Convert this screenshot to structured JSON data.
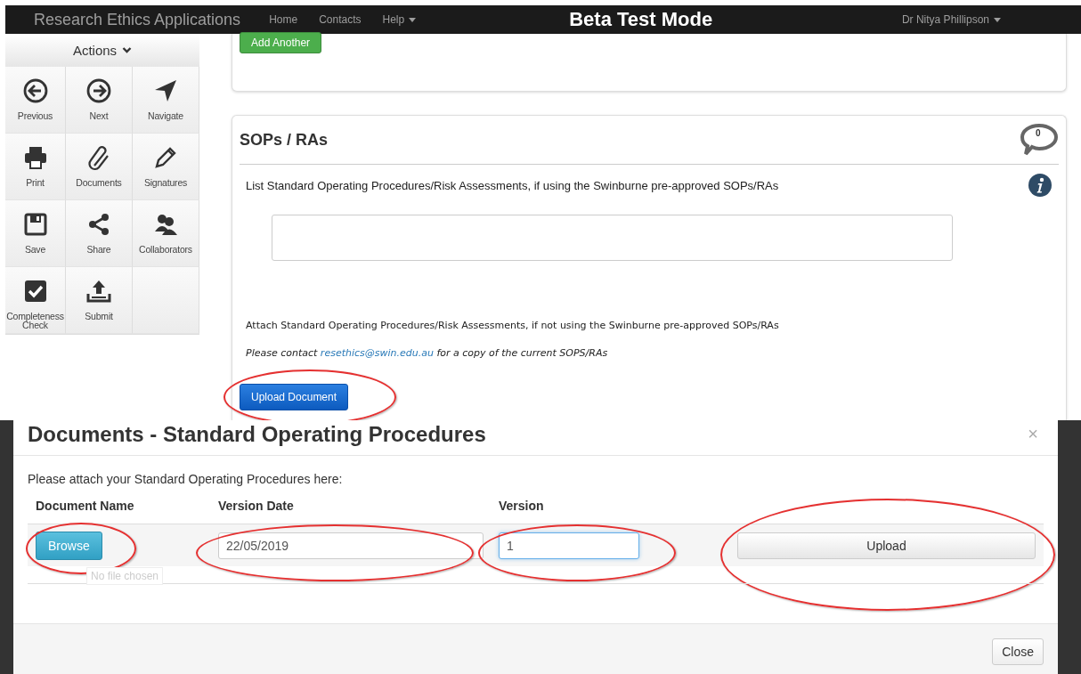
{
  "navbar": {
    "brand": "Research Ethics Applications",
    "links": [
      {
        "label": "Home",
        "caret": false
      },
      {
        "label": "Contacts",
        "caret": false
      },
      {
        "label": "Help",
        "caret": true
      }
    ],
    "mode": "Beta Test Mode",
    "user": "Dr Nitya Phillipson"
  },
  "sidebar": {
    "header": "Actions",
    "actions": [
      {
        "label": "Previous"
      },
      {
        "label": "Next"
      },
      {
        "label": "Navigate"
      },
      {
        "label": "Print"
      },
      {
        "label": "Documents"
      },
      {
        "label": "Signatures"
      },
      {
        "label": "Save"
      },
      {
        "label": "Share"
      },
      {
        "label": "Collaborators"
      },
      {
        "label": "Completeness Check"
      },
      {
        "label": "Submit"
      }
    ]
  },
  "previous_card": {
    "button": "Add Another"
  },
  "section": {
    "title": "SOPs / RAs",
    "comment_count": "0",
    "question": "List Standard Operating Procedures/Risk Assessments, if using the Swinburne pre-approved SOPs/RAs",
    "attach_text": "Attach Standard Operating Procedures/Risk Assessments, if not using the Swinburne pre-approved SOPs/RAs",
    "contact_before": "Please contact",
    "contact_link": "resethics@swin.edu.au",
    "contact_after": "for a copy of the current SOPS/RAs",
    "upload_button": {
      "label": "Upload Document",
      "circled": true
    }
  },
  "dialog": {
    "title": "Documents - Standard Operating Procedures",
    "close_symbol": "×",
    "intro": "Please attach your Standard Operating Procedures here:",
    "columns": [
      "Document Name",
      "Version Date",
      "Version"
    ],
    "browse": {
      "label": "Browse",
      "circled": true
    },
    "tooltip": "No file chosen",
    "version_date": {
      "value": "22/05/2019",
      "circled": true
    },
    "version": {
      "value": "1",
      "circled": true,
      "focused": true
    },
    "upload": {
      "label": "Upload",
      "circled": true
    },
    "footer_button": "Close"
  }
}
